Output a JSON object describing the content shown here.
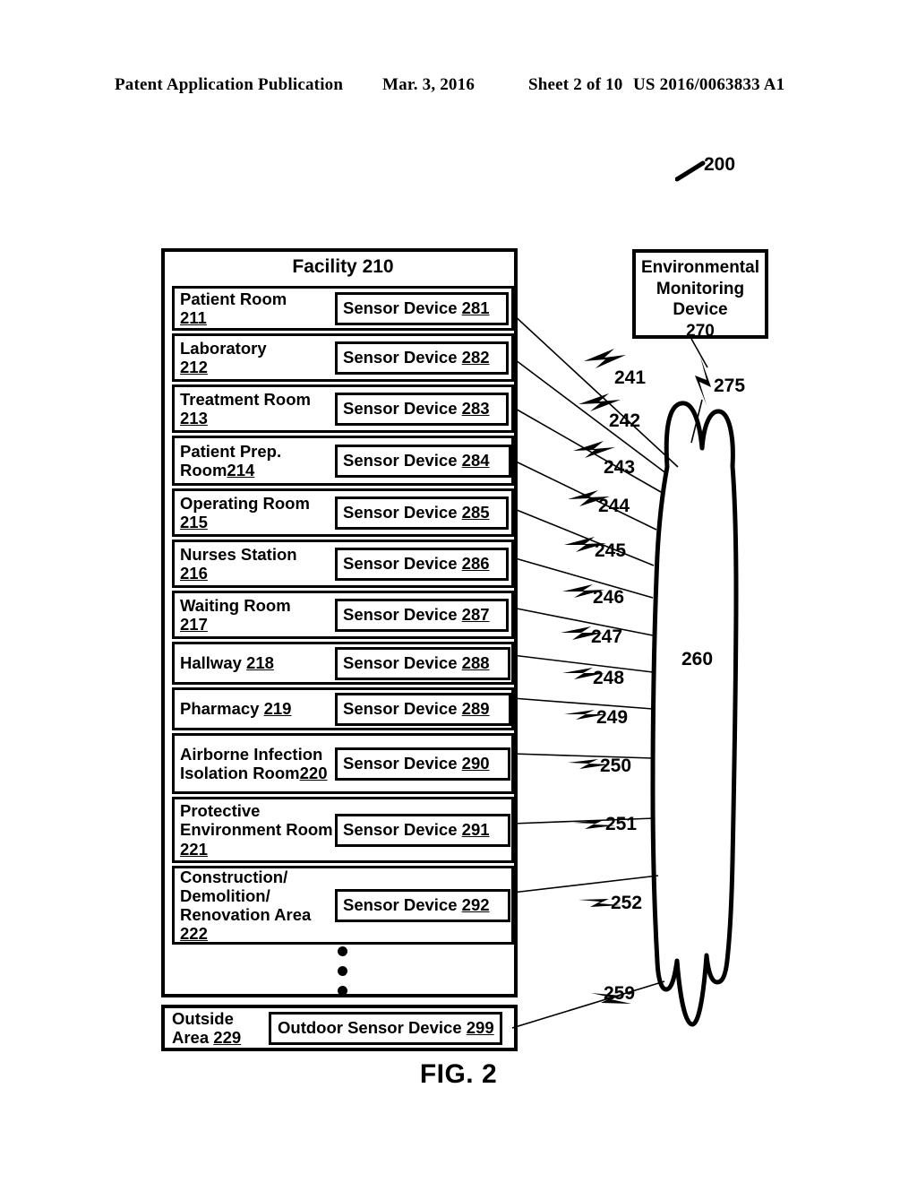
{
  "page_header": {
    "publication": "Patent Application Publication",
    "date": "Mar. 3, 2016",
    "sheet": "Sheet 2 of 10",
    "patent_number": "US 2016/0063833 A1"
  },
  "figure": {
    "caption": "FIG. 2",
    "system_ref": "200"
  },
  "facility": {
    "title": "Facility 210",
    "rooms": [
      {
        "name": "Patient Room",
        "ref": "211",
        "inline": false,
        "sensor_label": "Sensor Device ",
        "sensor_ref": "281",
        "connector_ref": "241"
      },
      {
        "name": "Laboratory",
        "ref": "212",
        "inline": false,
        "sensor_label": "Sensor Device ",
        "sensor_ref": "282",
        "connector_ref": "242"
      },
      {
        "name": "Treatment Room",
        "ref": "213",
        "inline": false,
        "sensor_label": "Sensor Device ",
        "sensor_ref": "283",
        "connector_ref": "243"
      },
      {
        "name": "Patient Prep. Room",
        "ref": "214",
        "inline": true,
        "sensor_label": "Sensor Device ",
        "sensor_ref": "284",
        "connector_ref": "244"
      },
      {
        "name": "Operating Room",
        "ref": "215",
        "inline": false,
        "sensor_label": "Sensor Device ",
        "sensor_ref": "285",
        "connector_ref": "245"
      },
      {
        "name": "Nurses Station",
        "ref": "216",
        "inline": false,
        "sensor_label": "Sensor Device ",
        "sensor_ref": "286",
        "connector_ref": "246"
      },
      {
        "name": "Waiting Room",
        "ref": "217",
        "inline": false,
        "sensor_label": "Sensor Device ",
        "sensor_ref": "287",
        "connector_ref": "247"
      },
      {
        "name": "Hallway ",
        "ref": "218",
        "inline": true,
        "sensor_label": "Sensor Device ",
        "sensor_ref": "288",
        "connector_ref": "248"
      },
      {
        "name": "Pharmacy ",
        "ref": "219",
        "inline": true,
        "sensor_label": "Sensor Device ",
        "sensor_ref": "289",
        "connector_ref": "249"
      },
      {
        "name": "Airborne Infection Isolation Room",
        "ref": "220",
        "inline": true,
        "sensor_label": "Sensor Device ",
        "sensor_ref": "290",
        "connector_ref": "250"
      },
      {
        "name": "Protective Environment Room ",
        "ref": "221",
        "inline": true,
        "sensor_label": "Sensor Device ",
        "sensor_ref": "291",
        "connector_ref": "251"
      },
      {
        "name": "Construction/ Demolition/ Renovation Area ",
        "ref": "222",
        "inline": true,
        "sensor_label": "Sensor Device ",
        "sensor_ref": "292",
        "connector_ref": "252"
      }
    ],
    "continuation_symbol": "vertical-ellipsis"
  },
  "outside_area": {
    "name": "Outside Area ",
    "ref": "229",
    "sensor_label": "Outdoor Sensor Device ",
    "sensor_ref": "299",
    "connector_ref": "259"
  },
  "monitoring_device": {
    "line1": "Environmental",
    "line2": "Monitoring",
    "line3": "Device",
    "ref": "270",
    "connector_ref": "275"
  },
  "network": {
    "label": "260",
    "shape": "cloud"
  },
  "colors": {
    "ink": "#000000",
    "paper": "#ffffff"
  }
}
